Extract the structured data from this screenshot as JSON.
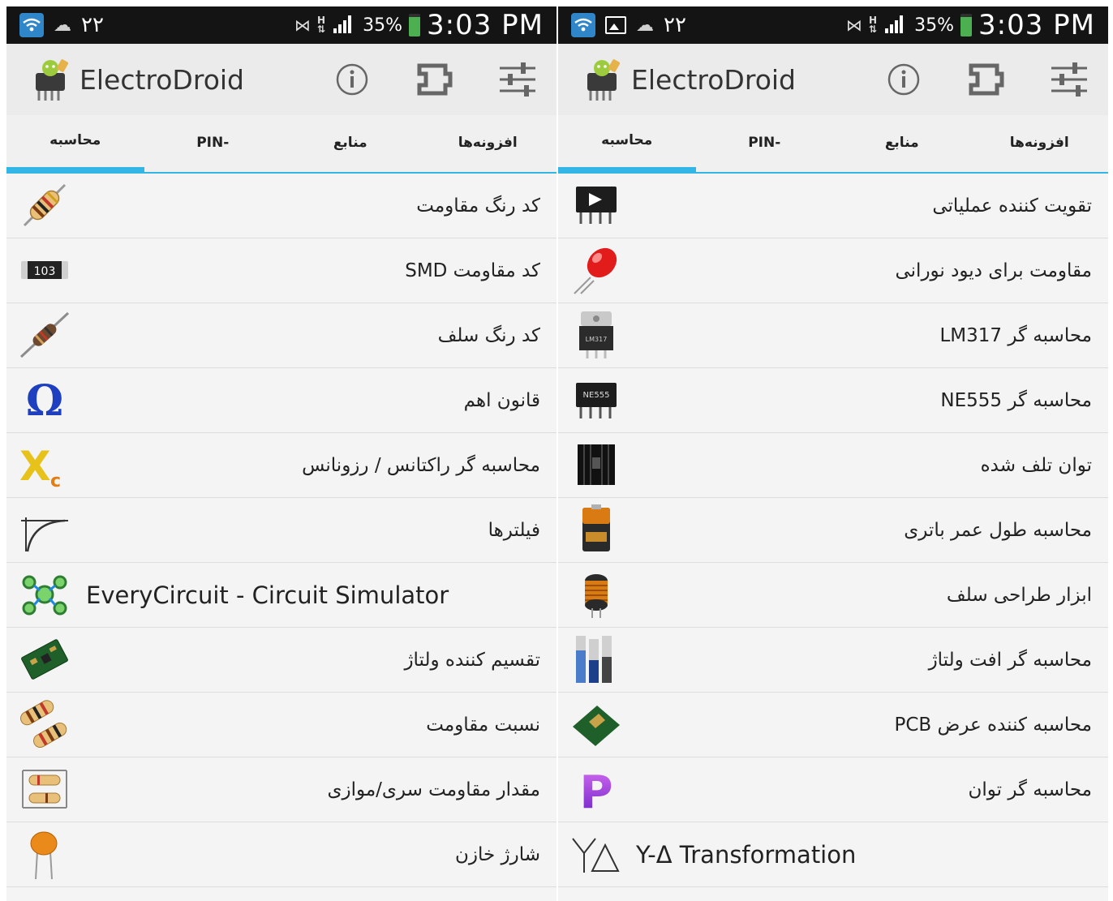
{
  "panels": [
    {
      "status": {
        "signal_num": "۲۲",
        "battery_pct": "35%",
        "time": "3:03 PM",
        "h_indicator": "H"
      },
      "app": {
        "title": "ElectroDroid"
      },
      "tabs": [
        "محاسبه",
        "PIN-",
        "منابع",
        "افزونه‌ها"
      ],
      "active_tab": 0,
      "items": [
        {
          "label": "کد رنگ مقاومت",
          "icon": "resistor-icon"
        },
        {
          "label": "کد مقاومت SMD",
          "icon": "smd-resistor-icon"
        },
        {
          "label": "کد رنگ سلف",
          "icon": "inductor-icon"
        },
        {
          "label": "قانون اهم",
          "icon": "ohm-icon"
        },
        {
          "label": "محاسبه گر راکتانس / رزونانس",
          "icon": "reactance-icon"
        },
        {
          "label": "فیلترها",
          "icon": "filter-curve-icon"
        },
        {
          "label": "EveryCircuit - Circuit Simulator",
          "icon": "everycircuit-icon"
        },
        {
          "label": "تقسیم کننده ولتاژ",
          "icon": "voltage-divider-icon"
        },
        {
          "label": "نسبت مقاومت",
          "icon": "resistor-ratio-icon"
        },
        {
          "label": "مقدار مقاومت سری/موازی",
          "icon": "series-parallel-icon"
        },
        {
          "label": "شارژ خازن",
          "icon": "capacitor-icon"
        }
      ],
      "icon_texts": {
        "smd": "103"
      }
    },
    {
      "status": {
        "signal_num": "۲۲",
        "battery_pct": "35%",
        "time": "3:03 PM",
        "h_indicator": "H"
      },
      "app": {
        "title": "ElectroDroid"
      },
      "tabs": [
        "محاسبه",
        "PIN-",
        "منابع",
        "افزونه‌ها"
      ],
      "active_tab": 0,
      "items": [
        {
          "label": "تقویت کننده عملیاتی",
          "icon": "opamp-icon"
        },
        {
          "label": "مقاومت برای دیود نورانی",
          "icon": "led-icon"
        },
        {
          "label": "محاسبه گر LM317",
          "icon": "lm317-icon"
        },
        {
          "label": "محاسبه گر NE555",
          "icon": "ne555-icon"
        },
        {
          "label": "توان تلف شده",
          "icon": "heatsink-icon"
        },
        {
          "label": "محاسبه طول عمر باتری",
          "icon": "battery-icon"
        },
        {
          "label": "ابزار طراحی سلف",
          "icon": "coil-icon"
        },
        {
          "label": "محاسبه گر افت ولتاژ",
          "icon": "wires-icon"
        },
        {
          "label": "محاسبه کننده عرض PCB",
          "icon": "pcb-icon"
        },
        {
          "label": "محاسبه گر توان",
          "icon": "power-p-icon"
        },
        {
          "label": "Y-Δ Transformation",
          "icon": "y-delta-icon"
        }
      ],
      "icon_texts": {
        "ne555": "NE555",
        "lm317": "LM317"
      }
    }
  ],
  "colors": {
    "accent": "#33b5e5",
    "statusbar": "#141414",
    "appbar": "#ebebeb"
  }
}
